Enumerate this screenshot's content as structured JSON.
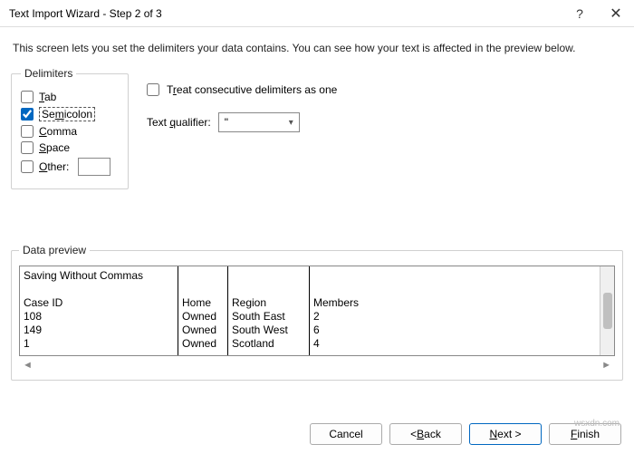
{
  "title": "Text Import Wizard - Step 2 of 3",
  "instruction": "This screen lets you set the delimiters your data contains.  You can see how your text is affected in the preview below.",
  "delimiters": {
    "legend": "Delimiters",
    "tab": "Tab",
    "semicolon": "Semicolon",
    "comma": "Comma",
    "space": "Space",
    "other": "Other:"
  },
  "options": {
    "treat_consecutive": "Treat consecutive delimiters as one",
    "text_qualifier_label": "Text qualifier:",
    "text_qualifier_value": "\""
  },
  "preview": {
    "legend": "Data preview",
    "col1": "Saving Without Commas\n\nCase ID\n108\n149\n1",
    "col2": "\n\nHome\nOwned\nOwned\nOwned",
    "col3": "\n\nRegion\nSouth East\nSouth West\nScotland",
    "col4": "\n\nMembers\n2\n6\n4"
  },
  "buttons": {
    "cancel": "Cancel",
    "back": "< Back",
    "next": "Next >",
    "finish": "Finish"
  },
  "watermark": "wsxdn.com"
}
